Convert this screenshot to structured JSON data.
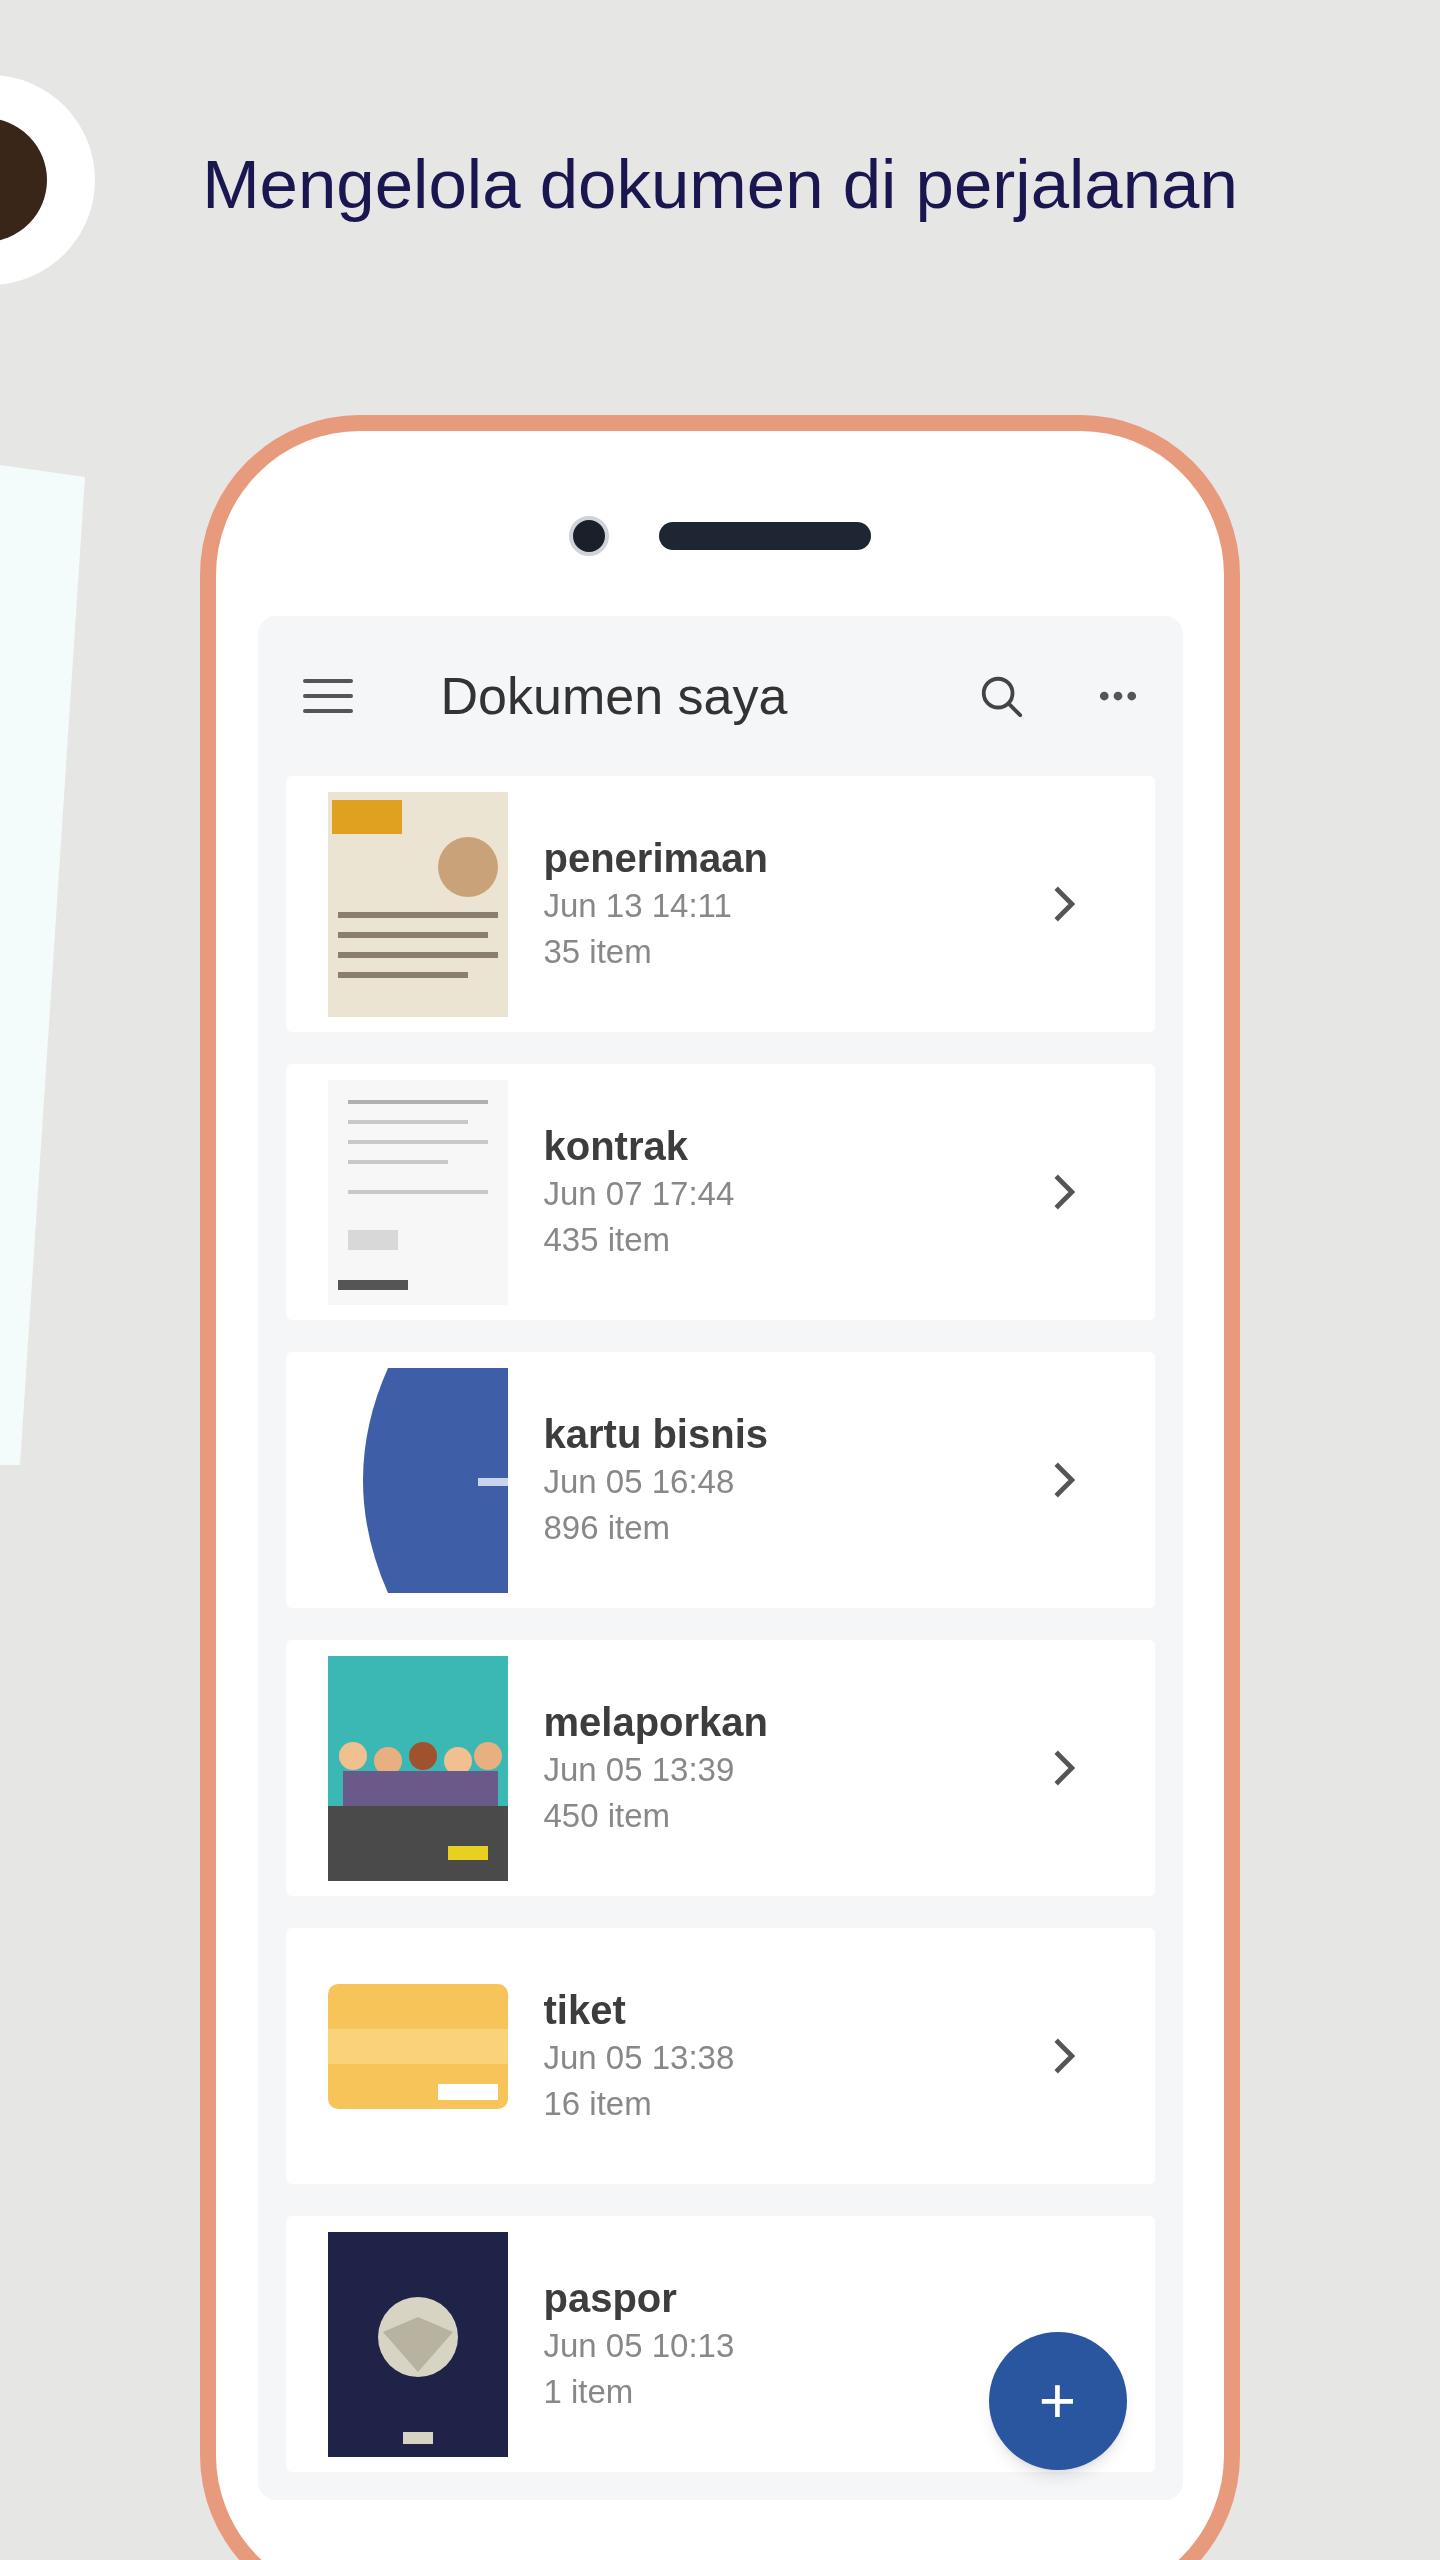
{
  "headline": "Mengelola dokumen di perjalanan",
  "app_bar": {
    "title": "Dokumen saya"
  },
  "documents": [
    {
      "title": "penerimaan",
      "date": "Jun 13 14:11",
      "count": "35 item",
      "chevron": true
    },
    {
      "title": "kontrak",
      "date": "Jun 07 17:44",
      "count": "435 item",
      "chevron": true
    },
    {
      "title": "kartu bisnis",
      "date": "Jun 05 16:48",
      "count": "896 item",
      "chevron": true
    },
    {
      "title": "melaporkan",
      "date": "Jun 05 13:39",
      "count": "450 item",
      "chevron": true
    },
    {
      "title": "tiket",
      "date": "Jun 05 13:38",
      "count": "16 item",
      "chevron": true
    },
    {
      "title": "paspor",
      "date": "Jun 05 10:13",
      "count": "1 item",
      "chevron": false
    }
  ],
  "fab": {
    "label": "+"
  }
}
